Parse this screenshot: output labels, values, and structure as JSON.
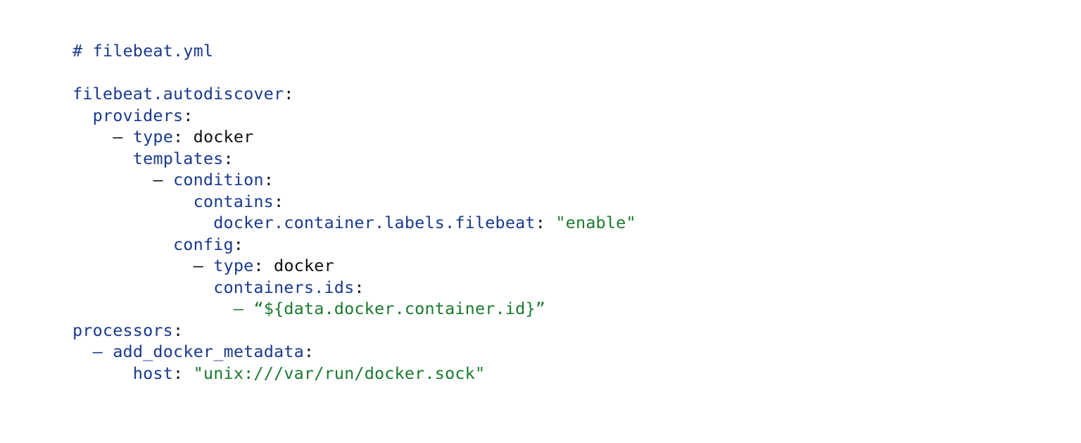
{
  "document": {
    "filename": "filebeat.yml",
    "language": "yaml",
    "background_color": "#ffffff",
    "colors": {
      "key": "#1a3a8f",
      "string": "#1a7a2e",
      "plain": "#101010",
      "punctuation": "#101010",
      "comment": "#1a3a8f"
    }
  },
  "code": {
    "lines": [
      {
        "n": 1,
        "text": "# filebeat.yml",
        "tokens": [
          {
            "t": "# filebeat.yml",
            "c": "comment"
          }
        ]
      },
      {
        "n": 2,
        "text": "",
        "tokens": []
      },
      {
        "n": 3,
        "text": "filebeat.autodiscover:",
        "tokens": [
          {
            "t": "filebeat.autodiscover",
            "c": "key"
          },
          {
            "t": ":",
            "c": "punct"
          }
        ]
      },
      {
        "n": 4,
        "text": "  providers:",
        "tokens": [
          {
            "t": "  ",
            "c": "indent"
          },
          {
            "t": "providers",
            "c": "key"
          },
          {
            "t": ":",
            "c": "punct"
          }
        ]
      },
      {
        "n": 5,
        "text": "    - type: docker",
        "tokens": [
          {
            "t": "    ",
            "c": "indent"
          },
          {
            "t": "–",
            "c": "dash"
          },
          {
            "t": " ",
            "c": "indent"
          },
          {
            "t": "type",
            "c": "key"
          },
          {
            "t": ":",
            "c": "punct"
          },
          {
            "t": " ",
            "c": "indent"
          },
          {
            "t": "docker",
            "c": "plain"
          }
        ]
      },
      {
        "n": 6,
        "text": "      templates:",
        "tokens": [
          {
            "t": "      ",
            "c": "indent"
          },
          {
            "t": "templates",
            "c": "key"
          },
          {
            "t": ":",
            "c": "punct"
          }
        ]
      },
      {
        "n": 7,
        "text": "        - condition:",
        "tokens": [
          {
            "t": "        ",
            "c": "indent"
          },
          {
            "t": "–",
            "c": "dash"
          },
          {
            "t": " ",
            "c": "indent"
          },
          {
            "t": "condition",
            "c": "key"
          },
          {
            "t": ":",
            "c": "punct"
          }
        ]
      },
      {
        "n": 8,
        "text": "            contains:",
        "tokens": [
          {
            "t": "            ",
            "c": "indent"
          },
          {
            "t": "contains",
            "c": "key"
          },
          {
            "t": ":",
            "c": "punct"
          }
        ]
      },
      {
        "n": 9,
        "text": "              docker.container.labels.filebeat: \"enable\"",
        "tokens": [
          {
            "t": "              ",
            "c": "indent"
          },
          {
            "t": "docker.container.labels.filebeat",
            "c": "key"
          },
          {
            "t": ":",
            "c": "punct"
          },
          {
            "t": " ",
            "c": "indent"
          },
          {
            "t": "\"enable\"",
            "c": "string"
          }
        ]
      },
      {
        "n": 10,
        "text": "          config:",
        "tokens": [
          {
            "t": "          ",
            "c": "indent"
          },
          {
            "t": "config",
            "c": "key"
          },
          {
            "t": ":",
            "c": "punct"
          }
        ]
      },
      {
        "n": 11,
        "text": "            - type: docker",
        "tokens": [
          {
            "t": "            ",
            "c": "indent"
          },
          {
            "t": "–",
            "c": "dash"
          },
          {
            "t": " ",
            "c": "indent"
          },
          {
            "t": "type",
            "c": "key"
          },
          {
            "t": ":",
            "c": "punct"
          },
          {
            "t": " ",
            "c": "indent"
          },
          {
            "t": "docker",
            "c": "plain"
          }
        ]
      },
      {
        "n": 12,
        "text": "              containers.ids:",
        "tokens": [
          {
            "t": "              ",
            "c": "indent"
          },
          {
            "t": "containers.ids",
            "c": "key"
          },
          {
            "t": ":",
            "c": "punct"
          }
        ]
      },
      {
        "n": 13,
        "text": "                - “${data.docker.container.id}”",
        "tokens": [
          {
            "t": "                ",
            "c": "indent"
          },
          {
            "t": "–",
            "c": "dash-green"
          },
          {
            "t": " ",
            "c": "indent"
          },
          {
            "t": "“${data.docker.container.id}”",
            "c": "string"
          }
        ]
      },
      {
        "n": 14,
        "text": "processors:",
        "tokens": [
          {
            "t": "processors",
            "c": "key"
          },
          {
            "t": ":",
            "c": "punct"
          }
        ]
      },
      {
        "n": 15,
        "text": "  - add_docker_metadata:",
        "tokens": [
          {
            "t": "  ",
            "c": "indent"
          },
          {
            "t": "–",
            "c": "dash-blue"
          },
          {
            "t": " ",
            "c": "indent"
          },
          {
            "t": "add_docker_metadata",
            "c": "key"
          },
          {
            "t": ":",
            "c": "punct"
          }
        ]
      },
      {
        "n": 16,
        "text": "      host: \"unix:///var/run/docker.sock\"",
        "tokens": [
          {
            "t": "      ",
            "c": "indent"
          },
          {
            "t": "host",
            "c": "key"
          },
          {
            "t": ":",
            "c": "punct"
          },
          {
            "t": " ",
            "c": "indent"
          },
          {
            "t": "\"unix:///var/run/docker.sock\"",
            "c": "string"
          }
        ]
      }
    ]
  }
}
